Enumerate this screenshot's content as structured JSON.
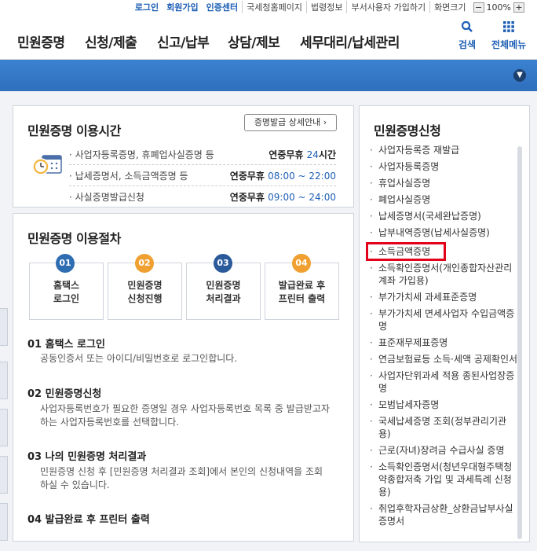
{
  "topbar": {
    "login": "로그인",
    "signup": "회원가입",
    "cert": "인증센터",
    "links": [
      "국세청홈페이지",
      "법령정보",
      "부서사용자 가입하기"
    ],
    "zoom_label": "화면크기",
    "zoom_minus": "−",
    "zoom_value": "100%",
    "zoom_plus": "+"
  },
  "nav": {
    "items": [
      "민원증명",
      "신청/제출",
      "신고/납부",
      "상담/제보",
      "세무대리/납세관리"
    ],
    "search_label": "검색",
    "menu_label": "전체메뉴"
  },
  "hours": {
    "title": "민원증명 이용시간",
    "detail_button": "증명발급 상세안내 ›",
    "rows": [
      {
        "label": "사업자등록증명, 휴폐업사실증명 등",
        "prefix": "연중무휴 ",
        "value": "24",
        "suffix": "시간"
      },
      {
        "label": "납세증명서, 소득금액증명 등",
        "prefix": "연중무휴 ",
        "value": "08:00 ~ 22:00",
        "suffix": ""
      },
      {
        "label": "사실증명발급신청",
        "prefix": "연중무휴 ",
        "value": "09:00 ~ 24:00",
        "suffix": ""
      }
    ]
  },
  "procedure": {
    "title": "민원증명 이용절차",
    "steps": [
      {
        "num": "01",
        "line1": "홈택스",
        "line2": "로그인",
        "color": "#2f6db3"
      },
      {
        "num": "02",
        "line1": "민원증명",
        "line2": "신청진행",
        "color": "#f0a030"
      },
      {
        "num": "03",
        "line1": "민원증명",
        "line2": "처리결과",
        "color": "#2a5a9a"
      },
      {
        "num": "04",
        "line1": "발급완료 후",
        "line2": "프린터 출력",
        "color": "#f0a030"
      }
    ],
    "sections": [
      {
        "title": "01 홈택스 로그인",
        "desc": "공동인증서 또는 아이디/비밀번호로 로그인합니다."
      },
      {
        "title": "02 민원증명신청",
        "desc": "사업자등록번호가 필요한 증명일 경우 사업자등록번호 목록 중 발급받고자 하는 사업자등록번호를 선택합니다."
      },
      {
        "title": "03 나의 민원증명 처리결과",
        "desc": "민원증명 신청 후 [민원증명 처리결과 조회]에서 본인의 신청내역을 조회하실 수 있습니다."
      },
      {
        "title": "04 발급완료 후 프린터 출력",
        "desc": ""
      }
    ]
  },
  "sidebar": {
    "title": "민원증명신청",
    "items": [
      "사업자등록증 재발급",
      "사업자등록증명",
      "휴업사실증명",
      "폐업사실증명",
      "납세증명서(국세완납증명)",
      "납부내역증명(납세사실증명)",
      "소득금액증명",
      "소득확인증명서(개인종합자산관리계좌 가입용)",
      "부가가치세 과세표준증명",
      "부가가치세 면세사업자 수입금액증명",
      "표준재무제표증명",
      "연금보험료등 소득·세액 공제확인서",
      "사업자단위과세 적용 종된사업장증명",
      "모범납세자증명",
      "국세납세증명 조회(정부관리기관용)",
      "근로(자녀)장려금 수급사실 증명",
      "소득확인증명서(청년우대형주택청약종합저축 가입 및 과세특례 신청용)",
      "취업후학자금상환_상환금납부사실증명서"
    ],
    "highlighted_index": 6,
    "highlight_color": "#e2001a"
  }
}
